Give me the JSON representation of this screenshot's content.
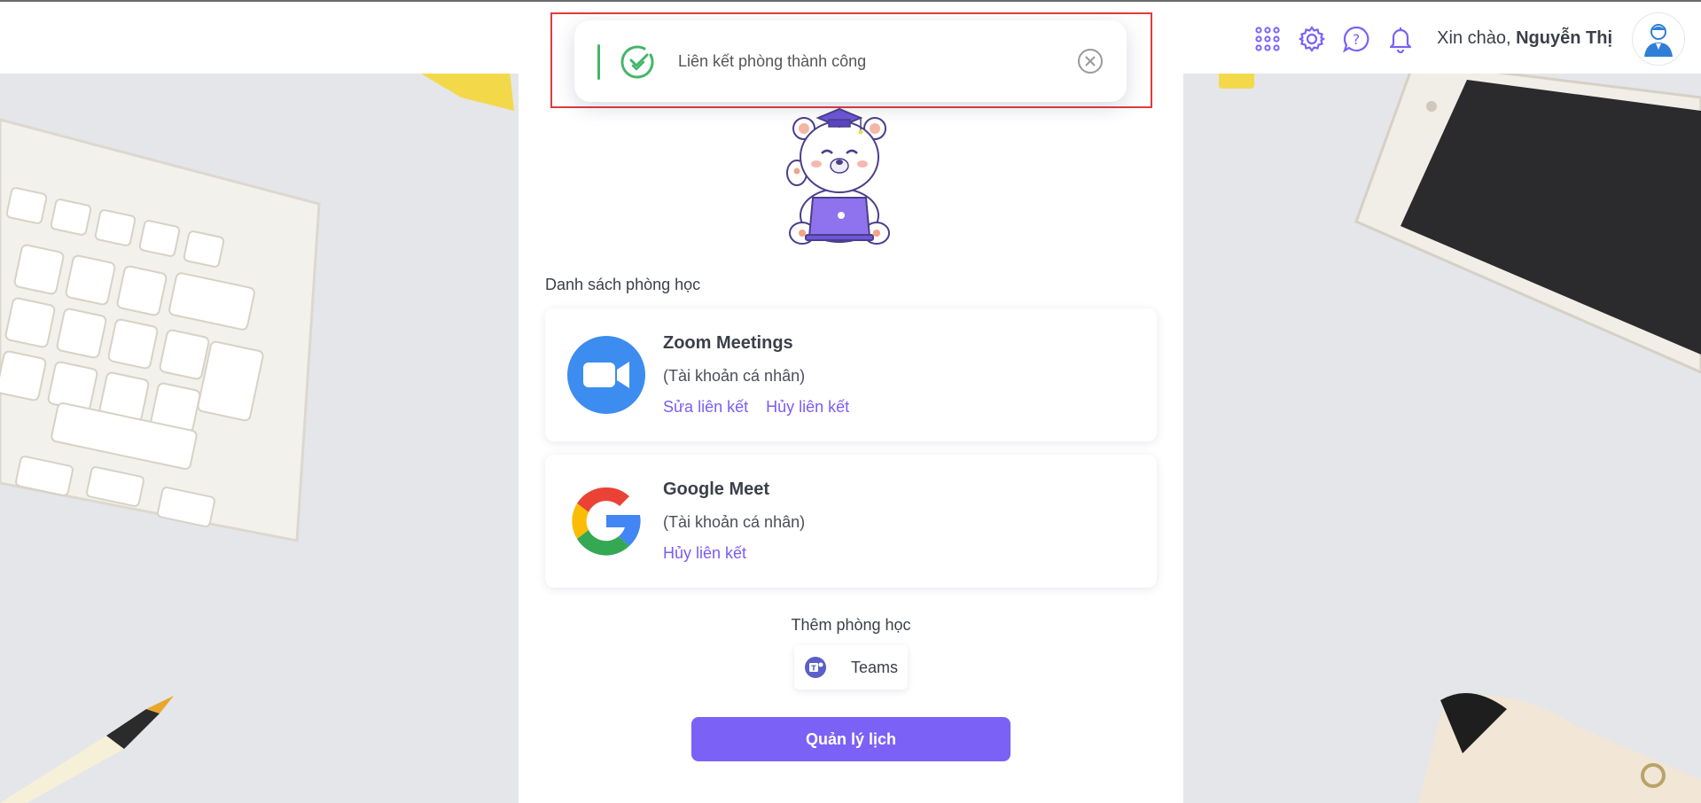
{
  "toast": {
    "message": "Liên kết phòng thành công",
    "accent_color": "#43b56a",
    "status_icon": "check-circle-icon",
    "close_icon": "close-circle-icon"
  },
  "header": {
    "icons": [
      "apps-grid-icon",
      "gear-icon",
      "help-icon",
      "bell-icon"
    ],
    "greeting_prefix": "Xin chào,",
    "user_name": "Nguyễn Thị",
    "avatar_icon": "user-avatar-icon"
  },
  "main": {
    "section_title": "Danh sách phòng học",
    "rooms": [
      {
        "name": "Zoom Meetings",
        "account_type": "(Tài khoản cá nhân)",
        "links": [
          "Sửa liên kết",
          "Hủy liên kết"
        ],
        "logo_icon": "zoom-logo-icon"
      },
      {
        "name": "Google Meet",
        "account_type": "(Tài khoản cá nhân)",
        "links": [
          "Hủy liên kết"
        ],
        "logo_icon": "google-logo-icon"
      }
    ],
    "add_room_title": "Thêm phòng học",
    "add_options": [
      {
        "label": "Teams",
        "icon": "teams-icon"
      }
    ],
    "manage_button": "Quản lý lịch"
  },
  "theme": {
    "primary": "#7b61f6",
    "link": "#7b5cf5",
    "highlight_box": "#e03c3c"
  }
}
